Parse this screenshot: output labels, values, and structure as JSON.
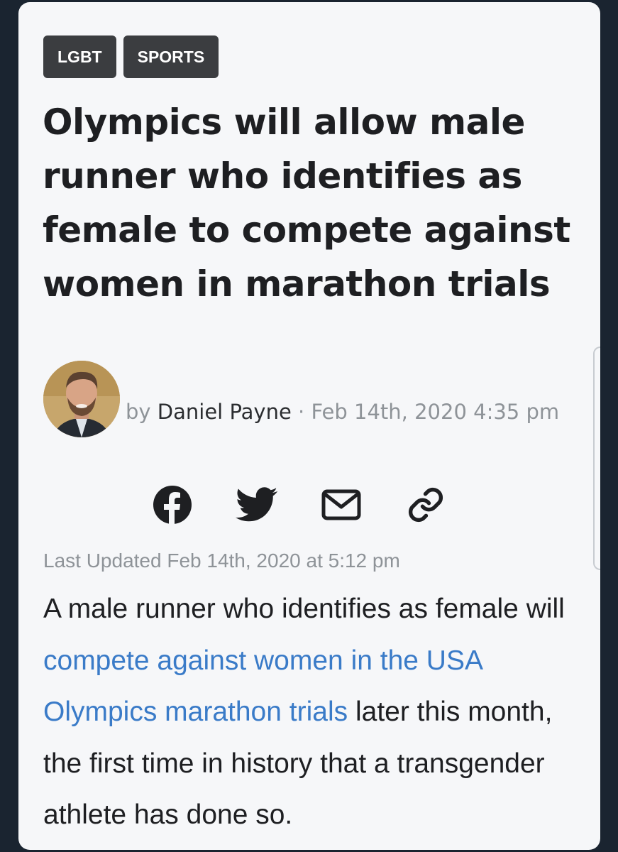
{
  "article": {
    "tags": [
      "LGBT",
      "SPORTS"
    ],
    "headline": "Olympics will allow male runner who identifies as female to compete against women in marathon trials",
    "byline": {
      "prefix": "by ",
      "author": "Daniel Payne",
      "separator": " · ",
      "date": "Feb 14th, 2020 4:35 pm"
    },
    "share_icons": [
      "facebook-icon",
      "twitter-icon",
      "email-icon",
      "link-icon"
    ],
    "last_updated": "Last Updated Feb 14th, 2020 at 5:12 pm",
    "body": {
      "part1": "A male runner who identifies as female will ",
      "link_text": "compete against women in the USA Olympics marathon trials",
      "part2": " later this month, the first time in history that a transgender athlete has done so."
    }
  },
  "colors": {
    "page_bg": "#1a2430",
    "card_bg": "#f6f7f9",
    "tag_bg": "#3b3d40",
    "link": "#3a7bc8",
    "muted": "#8e9398",
    "text": "#1e1f22"
  }
}
